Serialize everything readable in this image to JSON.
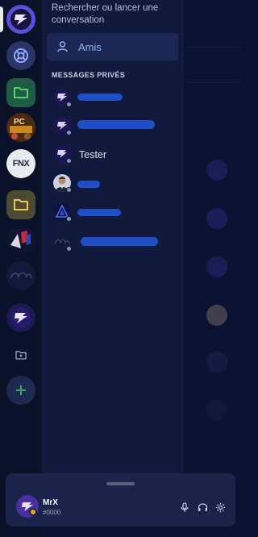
{
  "search": {
    "hint": "Rechercher ou lancer une conversation"
  },
  "friends": {
    "label": "Amis"
  },
  "dms": {
    "heading": "MESSAGES PRIVÉS",
    "items": [
      {
        "name": ""
      },
      {
        "name": ""
      },
      {
        "name": "Tester"
      },
      {
        "name": ""
      },
      {
        "name": ""
      },
      {
        "name": ""
      }
    ]
  },
  "servers": [
    {
      "icon": "app-logo-icon"
    },
    {
      "icon": "lifebuoy-icon"
    },
    {
      "icon": "folder-icon"
    },
    {
      "icon": "pc-server-icon"
    },
    {
      "icon": "fnx-server-icon"
    },
    {
      "icon": "folder-icon"
    },
    {
      "icon": "flag-server-icon"
    },
    {
      "icon": "faded-server-icon"
    },
    {
      "icon": "app-logo-icon"
    },
    {
      "icon": "folder-plus-icon"
    },
    {
      "icon": "add-server-icon"
    }
  ],
  "server_text": {
    "pc": "PC",
    "fnx": "FNX"
  },
  "user": {
    "name": "MrX",
    "tag": "#0000",
    "status_color": "#f0a030"
  },
  "colors": {
    "accent": "#5d73e0",
    "background": "#0c1331",
    "add_green": "#3ba55c",
    "folder_green": "#55d16a",
    "folder_yellow": "#f2c94c"
  }
}
